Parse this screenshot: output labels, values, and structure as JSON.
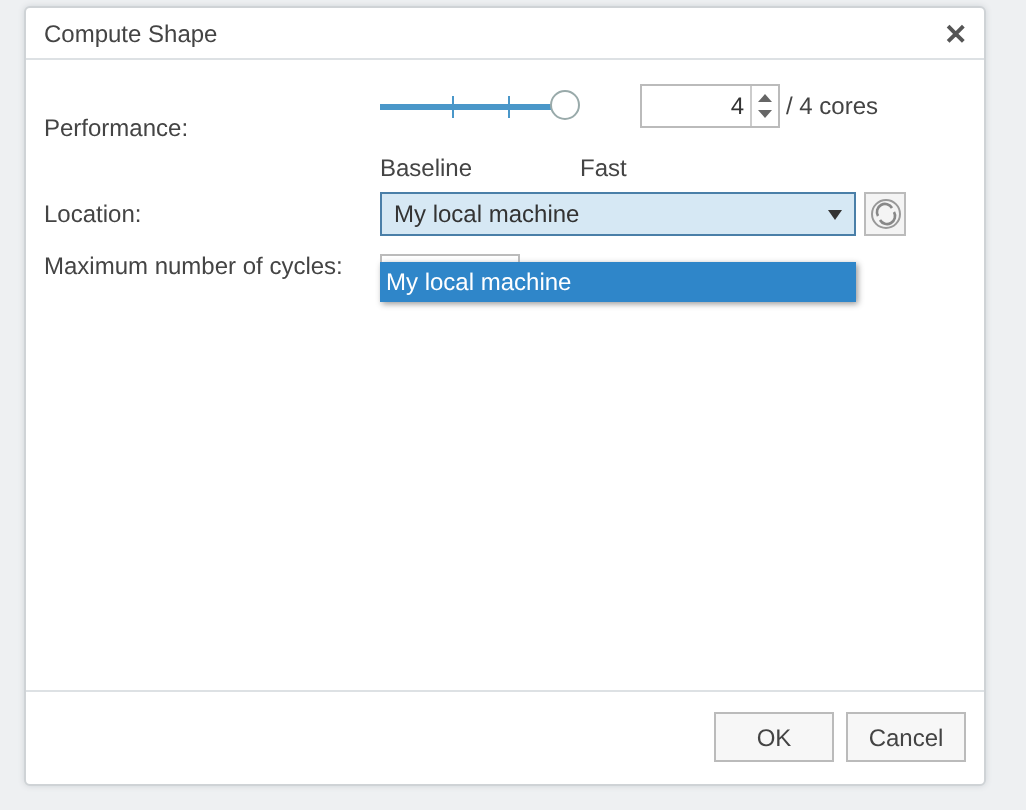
{
  "window": {
    "title": "Compute Shape",
    "close": "✕"
  },
  "performance": {
    "label": "Performance:",
    "level": 1,
    "min_label": "Baseline",
    "max_label": "Fast",
    "cores_value": "4",
    "cores_total": "/ 4 cores"
  },
  "location": {
    "label": "Location:",
    "value": "My local machine",
    "expanded": true,
    "options": [
      {
        "label": "My local machine",
        "selected": true
      }
    ]
  },
  "cycles": {
    "label": "Maximum number of cycles:"
  },
  "buttons": [
    {
      "label": "OK"
    },
    {
      "label": "Cancel"
    }
  ]
}
